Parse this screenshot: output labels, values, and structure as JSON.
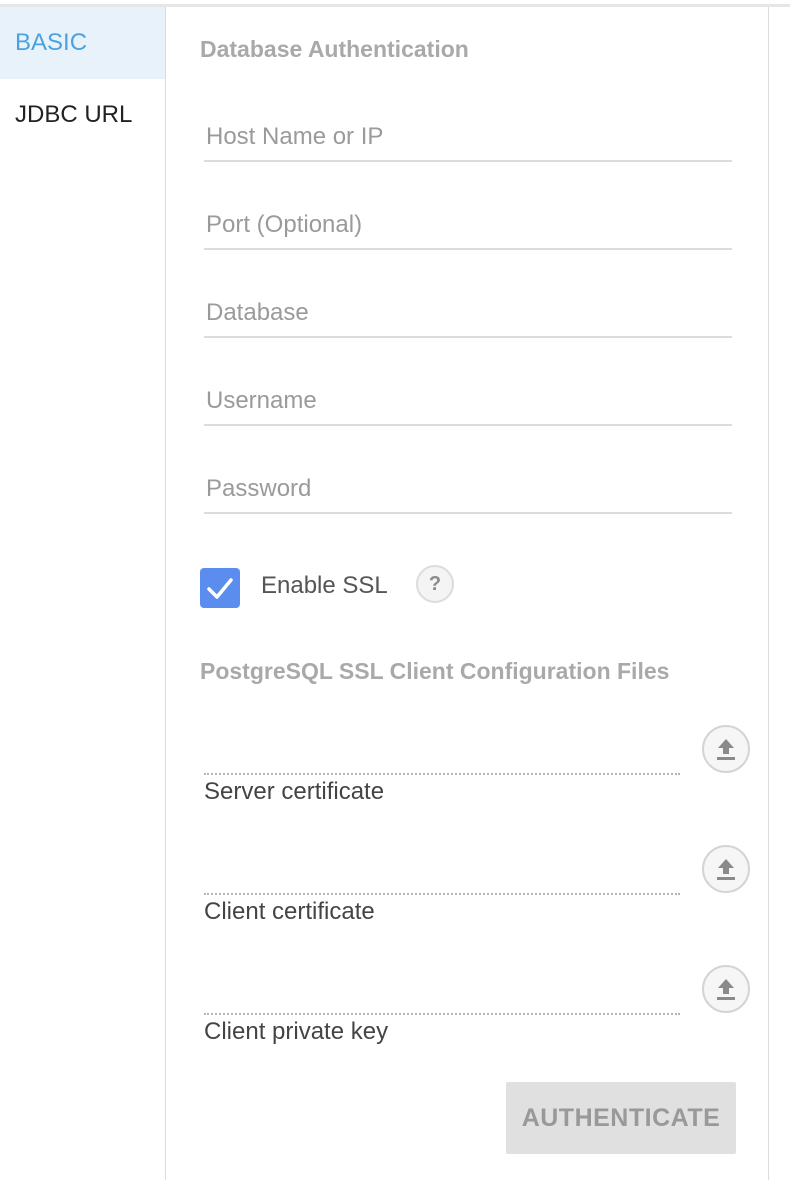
{
  "sidebar": {
    "items": [
      {
        "label": "BASIC",
        "active": true
      },
      {
        "label": "JDBC URL",
        "active": false
      }
    ]
  },
  "auth": {
    "title": "Database Authentication",
    "fields": {
      "host": {
        "placeholder": "Host Name or IP",
        "value": ""
      },
      "port": {
        "placeholder": "Port (Optional)",
        "value": ""
      },
      "database": {
        "placeholder": "Database",
        "value": ""
      },
      "username": {
        "placeholder": "Username",
        "value": ""
      },
      "password": {
        "placeholder": "Password",
        "value": ""
      }
    },
    "ssl": {
      "label": "Enable SSL",
      "checked": true,
      "help_glyph": "?"
    }
  },
  "ssl_files": {
    "title": "PostgreSQL SSL Client Configuration Files",
    "items": [
      {
        "label": "Server certificate",
        "icon": "upload-icon"
      },
      {
        "label": "Client certificate",
        "icon": "upload-icon"
      },
      {
        "label": "Client private key",
        "icon": "upload-icon"
      }
    ]
  },
  "actions": {
    "authenticate_label": "AUTHENTICATE"
  },
  "colors": {
    "accent": "#4aa3df",
    "checkbox": "#5b8dee",
    "active_bg": "#e8f2fb"
  }
}
